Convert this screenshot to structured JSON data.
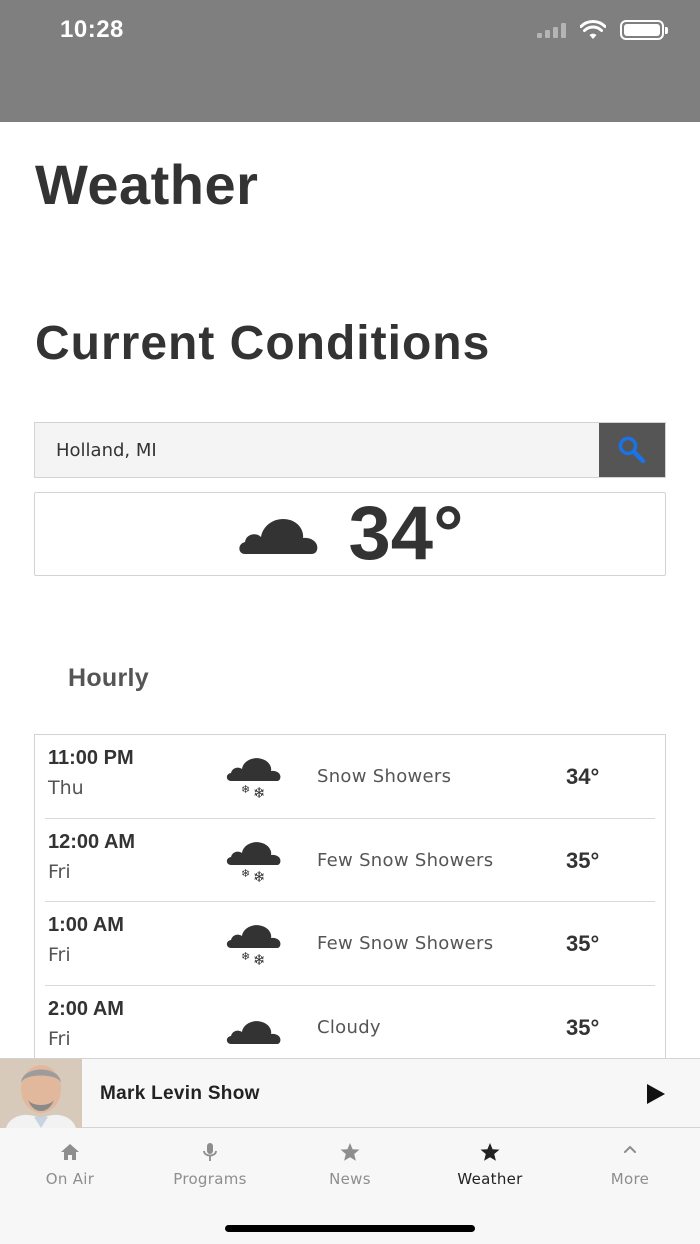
{
  "status": {
    "time": "10:28"
  },
  "page": {
    "title": "Weather",
    "section": "Current Conditions"
  },
  "search": {
    "value": "Holland, MI",
    "icon": "search-icon"
  },
  "current": {
    "icon": "cloud-icon",
    "temperature": "34°"
  },
  "hourly": {
    "title": "Hourly",
    "rows": [
      {
        "time": "11:00 PM",
        "day": "Thu",
        "icon": "snow-showers-icon",
        "condition": "Snow Showers",
        "temp": "34°"
      },
      {
        "time": "12:00 AM",
        "day": "Fri",
        "icon": "snow-showers-icon",
        "condition": "Few Snow Showers",
        "temp": "35°"
      },
      {
        "time": "1:00 AM",
        "day": "Fri",
        "icon": "snow-showers-icon",
        "condition": "Few Snow Showers",
        "temp": "35°"
      },
      {
        "time": "2:00 AM",
        "day": "Fri",
        "icon": "cloud-icon",
        "condition": "Cloudy",
        "temp": "35°"
      }
    ]
  },
  "player": {
    "title": "Mark Levin Show",
    "play_icon": "play-icon"
  },
  "tabs": [
    {
      "label": "On Air",
      "icon": "home-icon",
      "active": false
    },
    {
      "label": "Programs",
      "icon": "microphone-icon",
      "active": false
    },
    {
      "label": "News",
      "icon": "star-icon",
      "active": false
    },
    {
      "label": "Weather",
      "icon": "star-icon",
      "active": true
    },
    {
      "label": "More",
      "icon": "chevron-up-icon",
      "active": false
    }
  ],
  "colors": {
    "header": "#7f7f7f",
    "accent": "#1a73e8",
    "text": "#333333",
    "search_button": "#555555"
  }
}
